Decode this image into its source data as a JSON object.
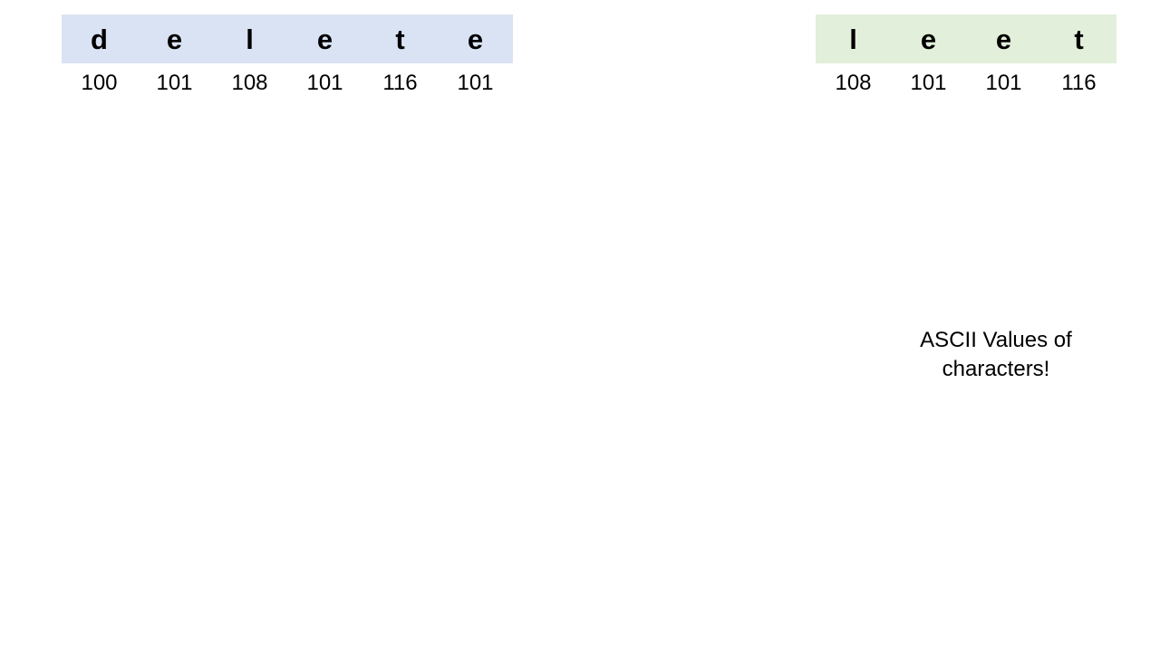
{
  "colors": {
    "left_word_fill": "#dae3f3",
    "right_word_fill": "#e2efda"
  },
  "left_word": {
    "chars": [
      "d",
      "e",
      "l",
      "e",
      "t",
      "e"
    ],
    "codes": [
      "100",
      "101",
      "108",
      "101",
      "116",
      "101"
    ]
  },
  "right_word": {
    "chars": [
      "l",
      "e",
      "e",
      "t"
    ],
    "codes": [
      "108",
      "101",
      "101",
      "116"
    ]
  },
  "caption": {
    "line1": "ASCII Values of",
    "line2": "characters!"
  }
}
